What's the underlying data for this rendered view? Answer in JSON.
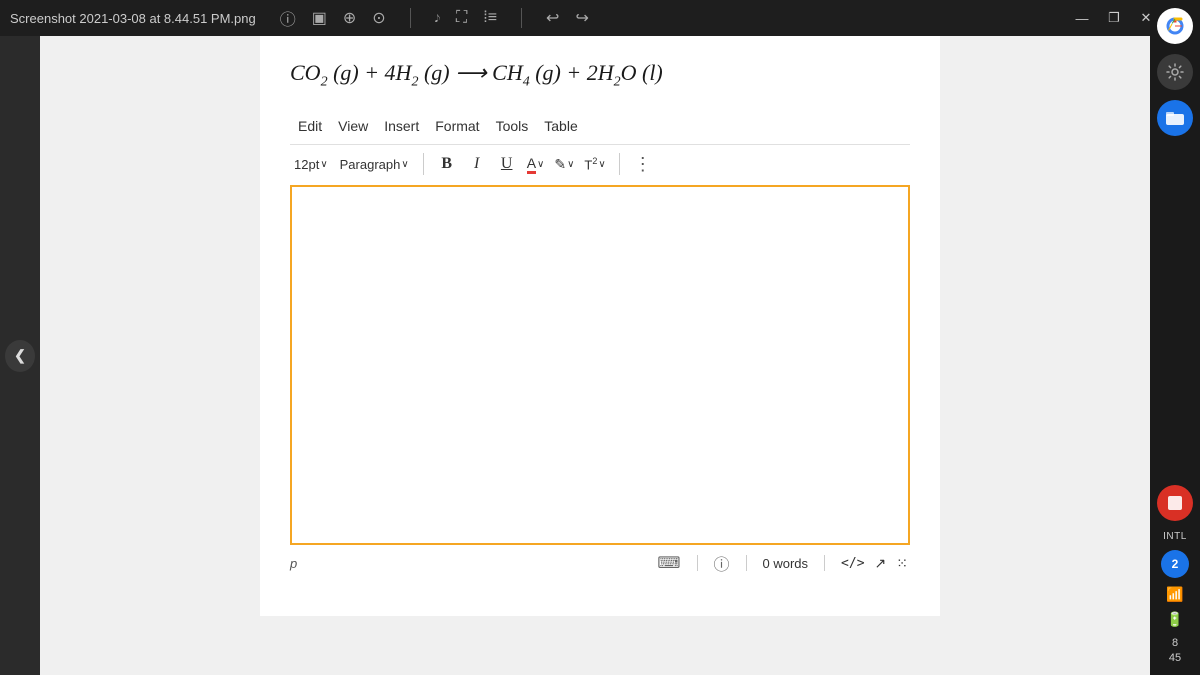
{
  "titlebar": {
    "title": "Screenshot 2021-03-08 at 8.44.51 PM.png",
    "minimize": "—",
    "restore": "❐",
    "close": "✕",
    "more": "⋮"
  },
  "toolbar_icons": {
    "info": "ⓘ",
    "square": "☐",
    "search1": "🔍",
    "search2": "🔍",
    "gesture": "☞",
    "crop": "⛶",
    "adjustments": "≡",
    "undo": "↩",
    "redo": "↪"
  },
  "formula": {
    "text": "CO₂ (g) + 4H₂ (g) → CH₄ (g) + 2H₂O (l)"
  },
  "menu": {
    "items": [
      "Edit",
      "View",
      "Insert",
      "Format",
      "Tools",
      "Table"
    ]
  },
  "formatting_toolbar": {
    "font_size": "12pt",
    "font_size_chevron": "∨",
    "paragraph": "Paragraph",
    "paragraph_chevron": "∨",
    "bold": "B",
    "italic": "I",
    "underline": "U",
    "font_color": "A",
    "font_color_chevron": "∨",
    "highlight": "✎",
    "highlight_chevron": "∨",
    "superscript": "T²",
    "superscript_chevron": "∨",
    "more": "⋮"
  },
  "status_bar": {
    "paragraph_label": "p",
    "keyboard_icon": "⌨",
    "info_icon": "ⓘ",
    "word_count": "0 words",
    "code_icon": "</>",
    "expand_icon": "↗",
    "more_icon": "⁙"
  },
  "nav": {
    "left_arrow": "❮",
    "right_arrow": "❯"
  },
  "system_tray": {
    "intl_label": "INTL",
    "number_2": "2",
    "time_hour": "8",
    "time_minute": "45"
  }
}
